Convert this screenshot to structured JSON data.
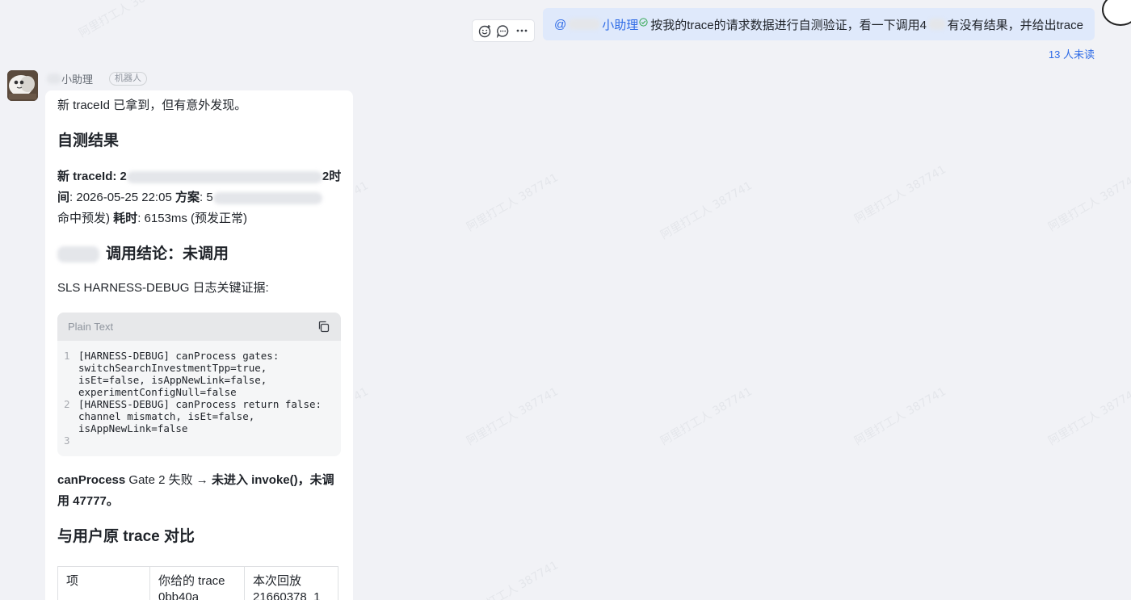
{
  "outgoing": {
    "mention_prefix": "@",
    "mention_name": "小助理",
    "text_part1": "按我的trace的请求数据进行自测验证，看一下调用4",
    "text_part2": "有没有结果，并给出trace",
    "unread": "13 人未读"
  },
  "bot": {
    "name": "小助理",
    "tag": "机器人",
    "intro": "新 traceId 已拿到，但有意外发现。",
    "h_result": "自测结果",
    "trace_label": "新 traceId",
    "trace_prefix": ": 2",
    "trace_suffix": "2时",
    "time_label": "间",
    "time_value": ": 2026-05-25 22:05",
    "plan_label": "方案",
    "plan_prefix": ": 5",
    "line3_part1": "命中预发)",
    "elapsed_label": "耗时",
    "elapsed_value": ": 6153ms (预发正常)",
    "h_conclusion": "调用结论：未调用",
    "sls_label": "SLS HARNESS-DEBUG 日志关键证据:",
    "code": {
      "lang": "Plain Text",
      "lines": [
        {
          "n": "1",
          "t": "[HARNESS-DEBUG] canProcess gates:\nswitchSearchInvestmentTpp=true,\nisEt=false, isAppNewLink=false,\nexperimentConfigNull=false"
        },
        {
          "n": "2",
          "t": "[HARNESS-DEBUG] canProcess return false:\nchannel mismatch, isEt=false,\nisAppNewLink=false"
        },
        {
          "n": "3",
          "t": ""
        }
      ]
    },
    "gate_b1": "canProcess",
    "gate_n1": " Gate 2 失败 → ",
    "gate_b2": "未进入 invoke()，未调",
    "gate_b3": "用 47777。",
    "h_compare": "与用户原 trace 对比",
    "table": {
      "headers": [
        "项",
        "你给的 trace",
        "本次回放"
      ],
      "row1": [
        "",
        "0bb40a",
        "21660378_1"
      ]
    }
  }
}
